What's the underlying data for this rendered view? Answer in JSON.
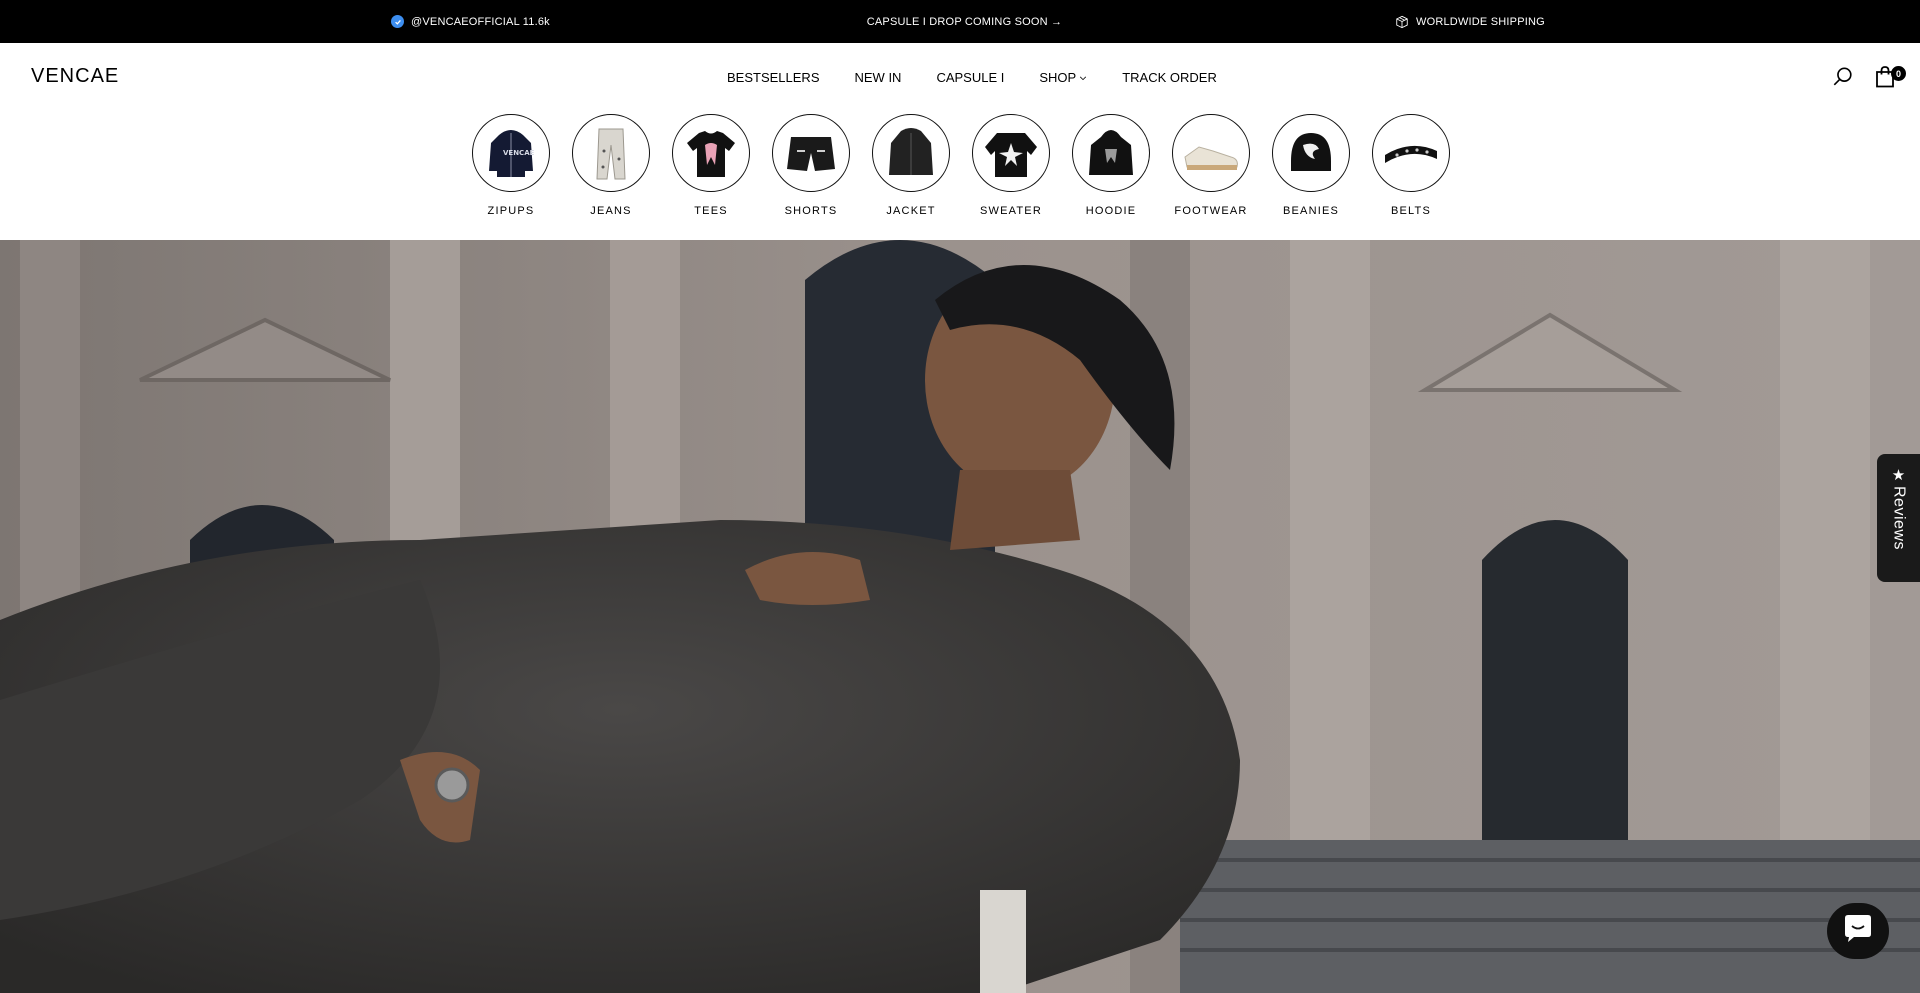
{
  "announcement": {
    "instagram": "@VENCAEOFFICIAL 11.6k",
    "center": "CAPSULE I DROP COMING SOON →",
    "shipping": "WORLDWIDE SHIPPING",
    "icons": {
      "verified": "verified-check-icon",
      "shipping": "package-box-icon"
    },
    "colors": {
      "background": "#000000",
      "text": "#ffffff",
      "verified": "#3d8ef0"
    }
  },
  "header": {
    "logo": "VENCAE",
    "nav": [
      "BESTSELLERS",
      "NEW IN",
      "CAPSULE I",
      "SHOP",
      "TRACK ORDER"
    ],
    "shop_has_dropdown": true,
    "icons": {
      "search": "search-icon",
      "cart": "shopping-bag-icon"
    },
    "cart_count": "0"
  },
  "categories": [
    {
      "label": "ZIPUPS",
      "icon": "zip-hoodie-icon"
    },
    {
      "label": "JEANS",
      "icon": "jeans-icon"
    },
    {
      "label": "TEES",
      "icon": "tshirt-icon"
    },
    {
      "label": "SHORTS",
      "icon": "shorts-icon"
    },
    {
      "label": "JACKET",
      "icon": "jacket-icon"
    },
    {
      "label": "SWEATER",
      "icon": "sweater-icon"
    },
    {
      "label": "HOODIE",
      "icon": "hoodie-icon"
    },
    {
      "label": "FOOTWEAR",
      "icon": "sneaker-icon"
    },
    {
      "label": "BEANIES",
      "icon": "beanie-icon"
    },
    {
      "label": "BELTS",
      "icon": "belt-icon"
    }
  ],
  "hero": {
    "image": "hero-photo-man-in-grey-fleece-hoodie"
  },
  "reviews_tab": {
    "label": "Reviews",
    "icon": "star-icon"
  },
  "chat": {
    "icon": "chat-bubble-icon"
  }
}
